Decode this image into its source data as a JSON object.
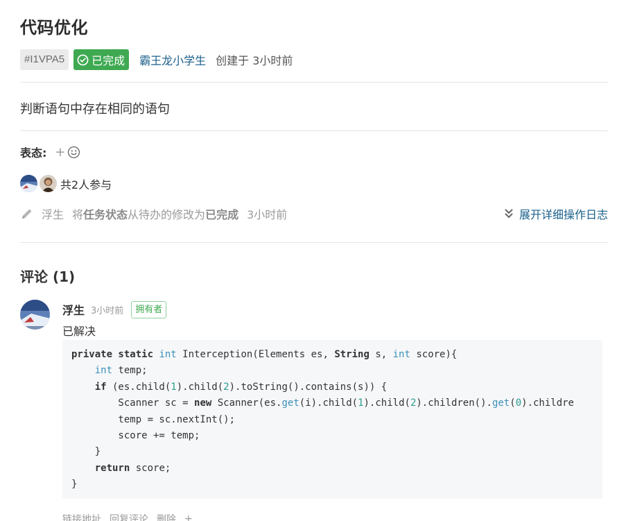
{
  "issue": {
    "title": "代码优化",
    "id": "#I1VPA5",
    "status": "已完成",
    "author": "霸王龙小学生",
    "created": "创建于 3小时前",
    "description": "判断语句中存在相同的语句"
  },
  "reactions": {
    "label": "表态:",
    "add_symbol": "+",
    "icon": "smiley-icon"
  },
  "participants": {
    "count_text": "共2人参与"
  },
  "log": {
    "user": "浮生",
    "action_prefix": "将",
    "field": "任务状态",
    "change_text": "从待办的修改为",
    "new_value": "已完成",
    "time": "3小时前",
    "expand_label": "展开详细操作日志"
  },
  "comments": {
    "title": "评论 (1)",
    "items": [
      {
        "author": "浮生",
        "time": "3小时前",
        "badge": "拥有者",
        "text": "已解决",
        "code": [
          [
            {
              "t": "private static ",
              "c": "kw"
            },
            {
              "t": "int",
              "c": "ty"
            },
            {
              "t": " Interception(Elements es, ",
              "c": ""
            },
            {
              "t": "String",
              "c": "kw"
            },
            {
              "t": " s, ",
              "c": ""
            },
            {
              "t": "int",
              "c": "ty"
            },
            {
              "t": " score){",
              "c": ""
            }
          ],
          [
            {
              "t": "    ",
              "c": ""
            },
            {
              "t": "int",
              "c": "ty"
            },
            {
              "t": " temp;",
              "c": ""
            }
          ],
          [
            {
              "t": "    ",
              "c": ""
            },
            {
              "t": "if",
              "c": "kw"
            },
            {
              "t": " (es.child(",
              "c": ""
            },
            {
              "t": "1",
              "c": "num"
            },
            {
              "t": ").child(",
              "c": ""
            },
            {
              "t": "2",
              "c": "num"
            },
            {
              "t": ").toString().contains(s)) {",
              "c": ""
            }
          ],
          [
            {
              "t": "        Scanner sc = ",
              "c": ""
            },
            {
              "t": "new",
              "c": "kw"
            },
            {
              "t": " Scanner(es.",
              "c": ""
            },
            {
              "t": "get",
              "c": "fn-blue"
            },
            {
              "t": "(i).child(",
              "c": ""
            },
            {
              "t": "1",
              "c": "num"
            },
            {
              "t": ").child(",
              "c": ""
            },
            {
              "t": "2",
              "c": "num"
            },
            {
              "t": ").children().",
              "c": ""
            },
            {
              "t": "get",
              "c": "fn-blue"
            },
            {
              "t": "(",
              "c": ""
            },
            {
              "t": "0",
              "c": "num"
            },
            {
              "t": ").childre",
              "c": ""
            }
          ],
          [
            {
              "t": "        temp = sc.nextInt();",
              "c": ""
            }
          ],
          [
            {
              "t": "        score += temp;",
              "c": ""
            }
          ],
          [
            {
              "t": "    }",
              "c": ""
            }
          ],
          [
            {
              "t": "    ",
              "c": ""
            },
            {
              "t": "return",
              "c": "kw"
            },
            {
              "t": " score;",
              "c": ""
            }
          ],
          [
            {
              "t": "}",
              "c": ""
            }
          ]
        ],
        "actions": [
          "链接地址",
          "回复评论",
          "删除",
          "+"
        ]
      }
    ]
  },
  "colors": {
    "status_green": "#3fa952",
    "link_blue": "#1a5f8a",
    "code_type": "#3a8fb7",
    "code_bg": "#f6f7f9"
  }
}
